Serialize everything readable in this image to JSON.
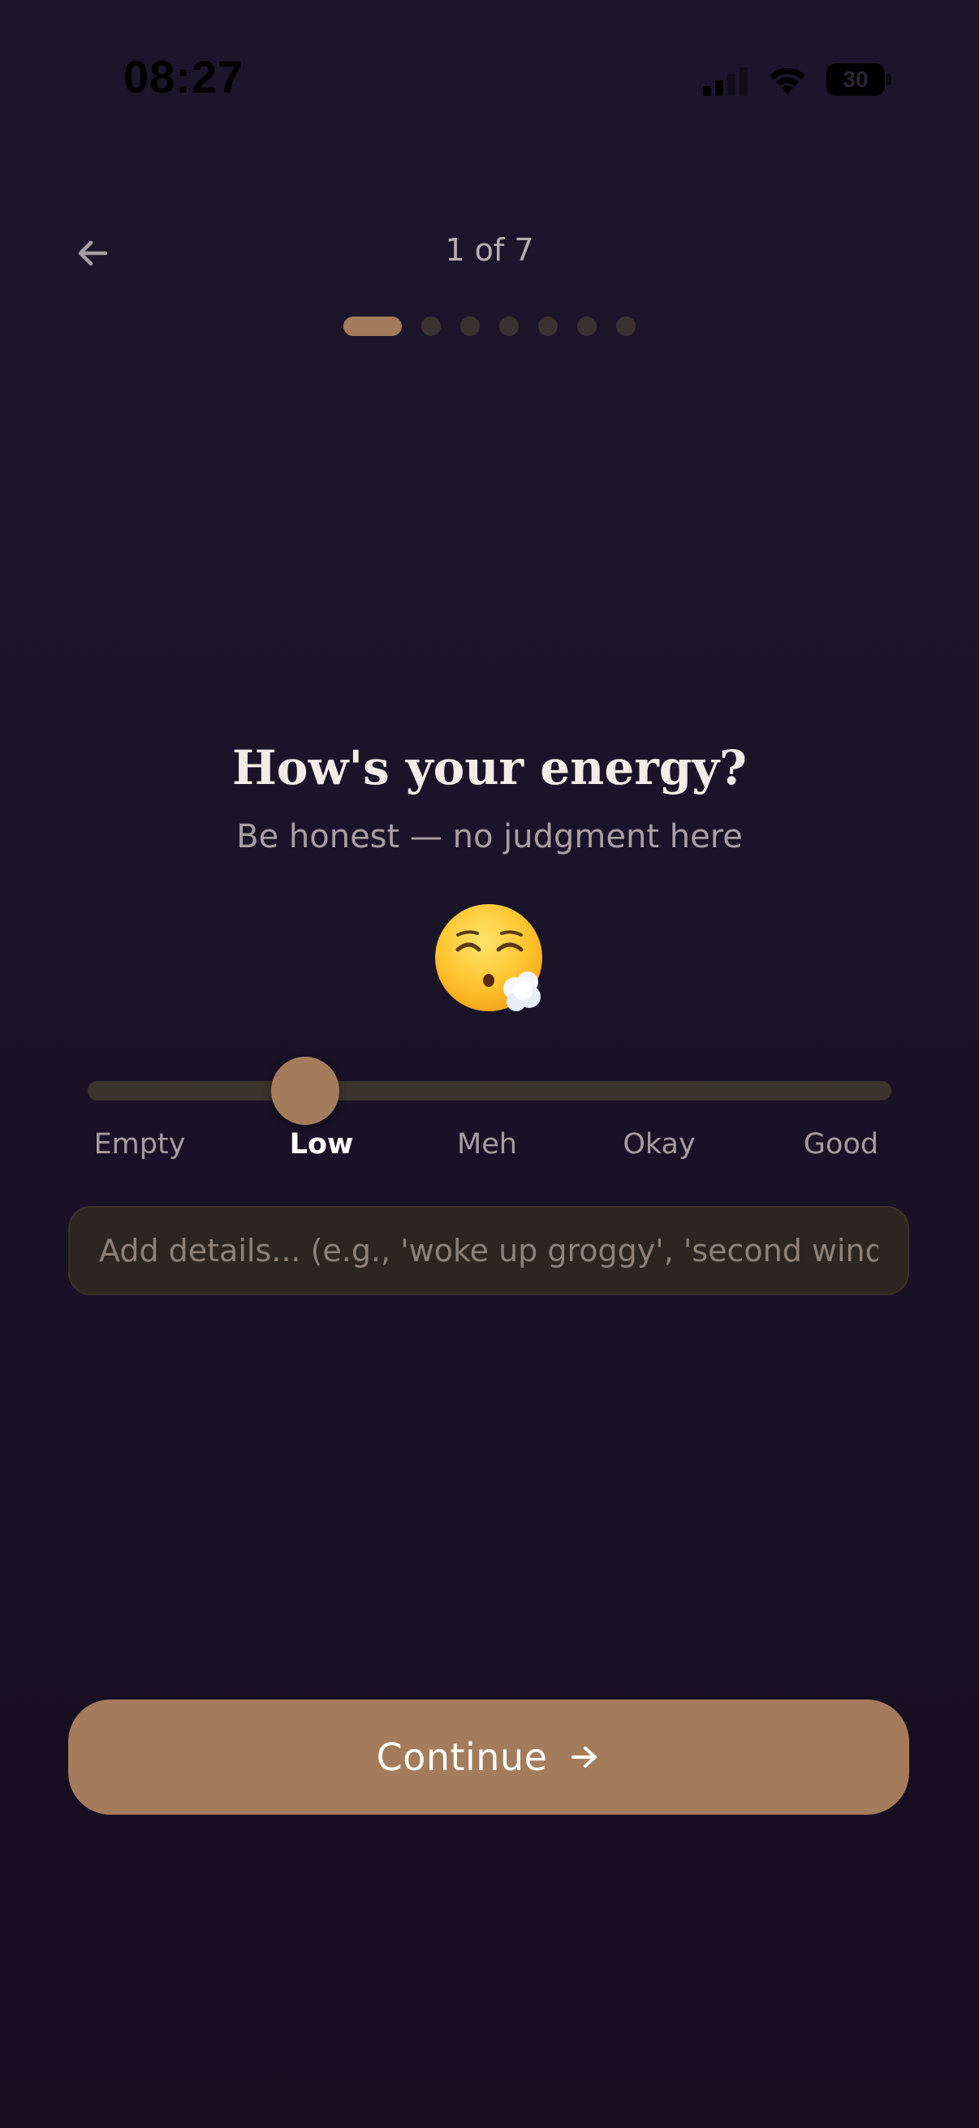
{
  "status_bar": {
    "time": "08:27",
    "battery_level": "30",
    "signal_icon": "cellular-signal-icon",
    "wifi_icon": "wifi-icon",
    "battery_icon": "battery-icon"
  },
  "header": {
    "back_icon": "arrow-left-icon",
    "step_label": "1 of 7",
    "total_steps": 7,
    "current_step": 1
  },
  "question": {
    "title": "How's your energy?",
    "subtitle": "Be honest — no judgment here",
    "emoji": "😮‍💨",
    "emoji_icon": "exhaling-face-icon"
  },
  "energy_slider": {
    "options": [
      "Empty",
      "Low",
      "Meh",
      "Okay",
      "Good"
    ],
    "selected_index": 1,
    "selected_label": "Low"
  },
  "details": {
    "value": "",
    "placeholder": "Add details... (e.g., 'woke up groggy', 'second wind after lunch')"
  },
  "continue_button": {
    "label": "Continue",
    "icon": "arrow-right-icon"
  },
  "colors": {
    "background": "#1a1428",
    "accent": "#a47c5b",
    "track": "#3a342d",
    "inactive_dot": "#3a3230",
    "input_background": "#2d251f"
  }
}
